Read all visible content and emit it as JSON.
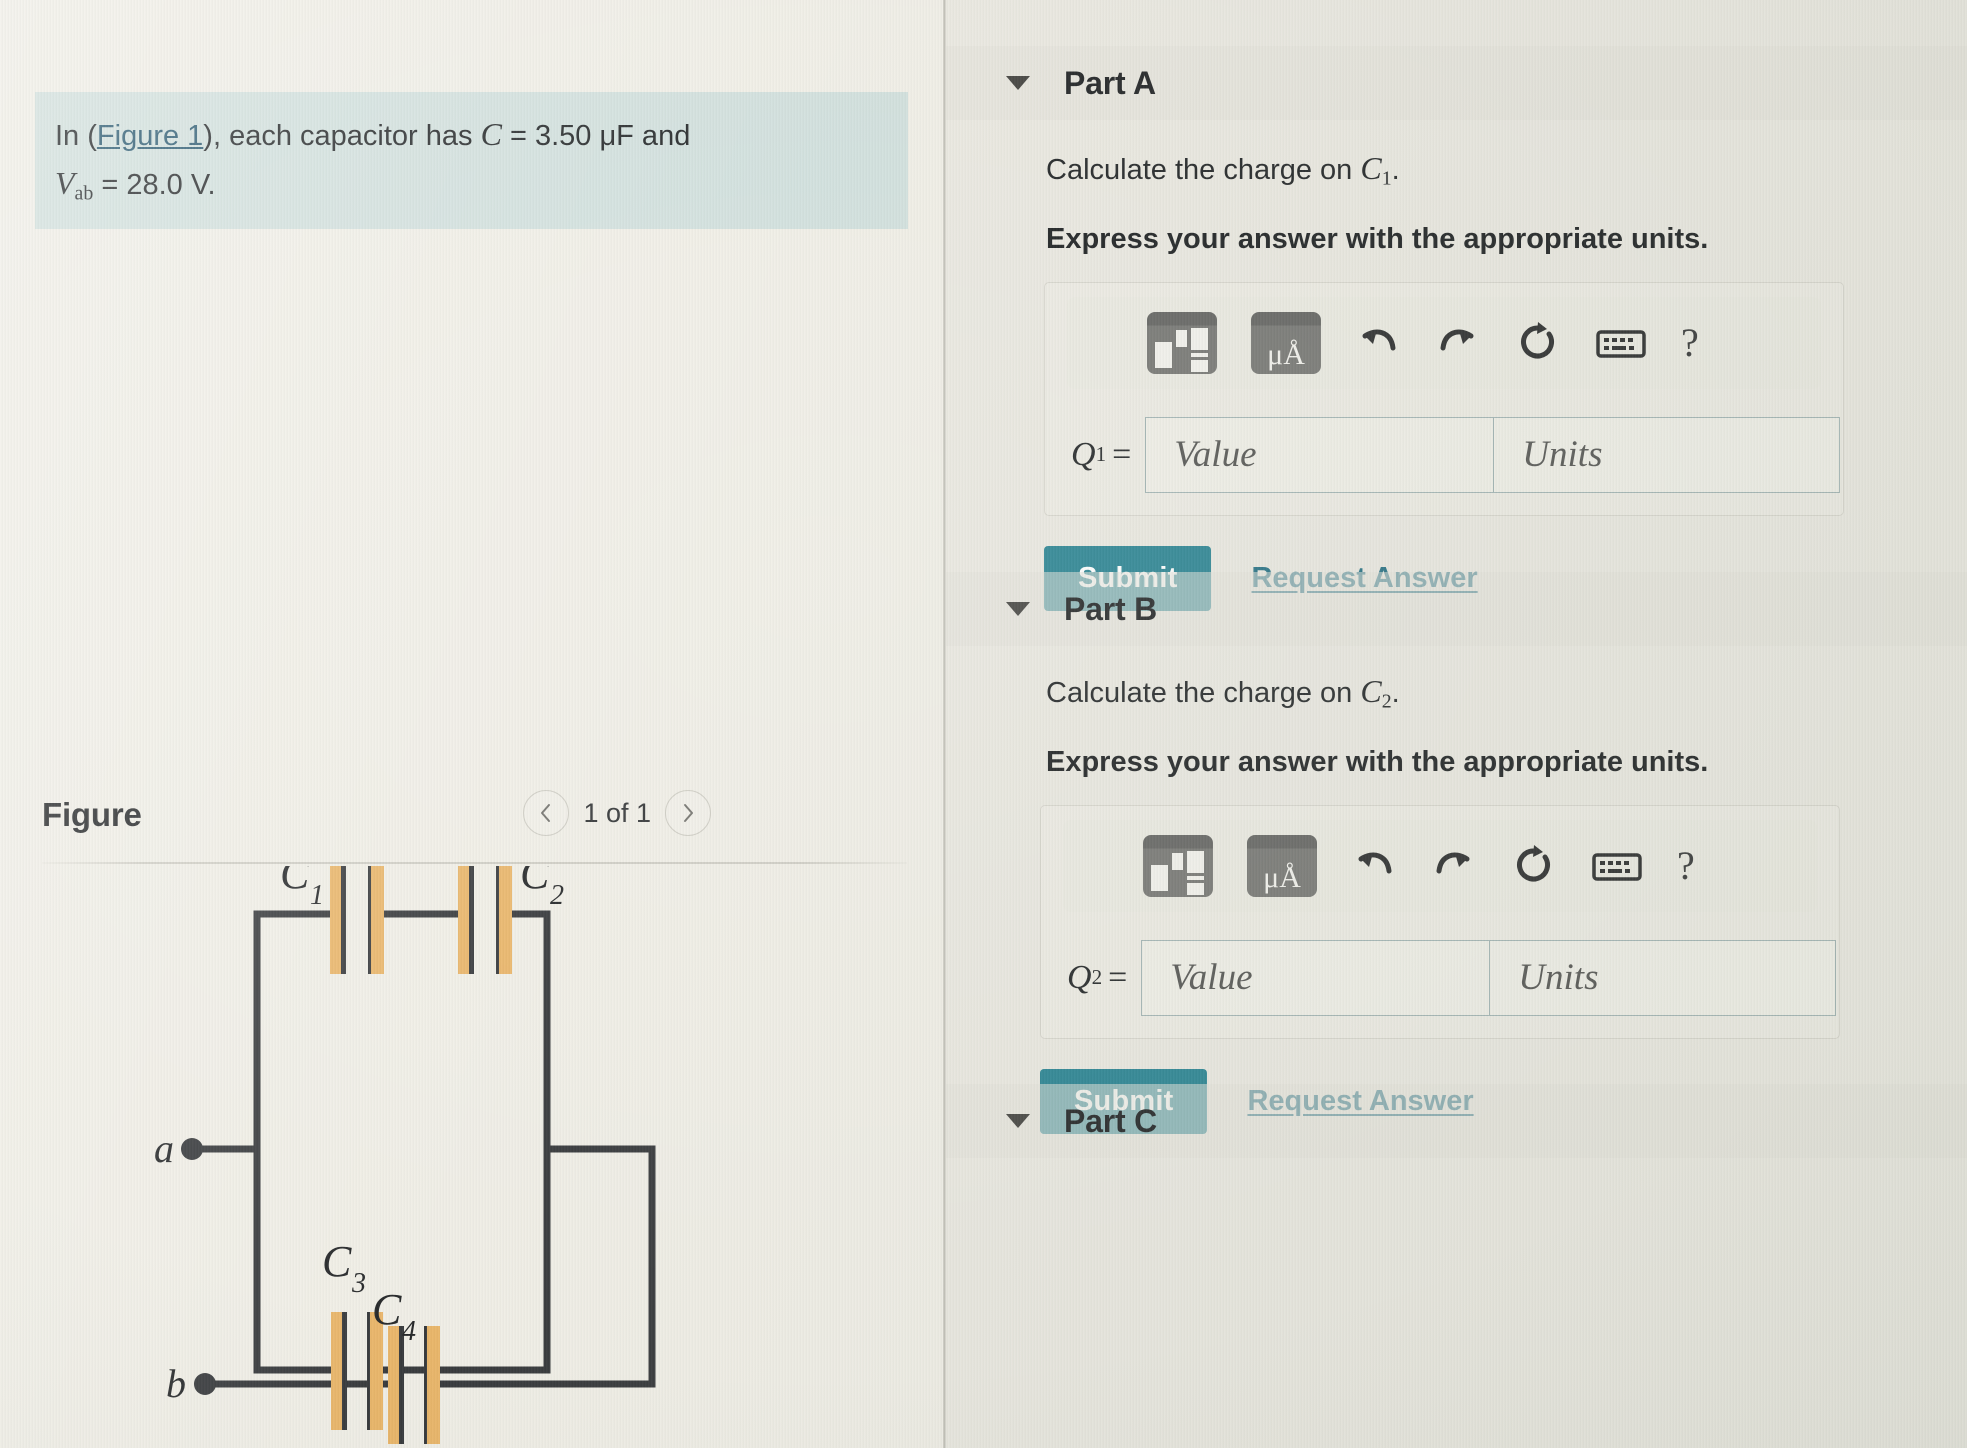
{
  "problem": {
    "text_prefix": "In (",
    "figure_link": "Figure 1",
    "text_mid": "), each capacitor has ",
    "capacitance_symbol": "C",
    "capacitance_value": " = 3.50 μF and",
    "voltage_symbol": "V",
    "voltage_subscript": "ab",
    "voltage_value": " = 28.0 V."
  },
  "figure": {
    "title": "Figure",
    "pager_label": "1 of 1",
    "prev_icon": "chevron-left-icon",
    "next_icon": "chevron-right-icon",
    "circuit": {
      "terminal_a": "a",
      "terminal_b": "b",
      "capacitors": [
        {
          "label": "C",
          "subscript": "1"
        },
        {
          "label": "C",
          "subscript": "2"
        },
        {
          "label": "C",
          "subscript": "3"
        },
        {
          "label": "C",
          "subscript": "4"
        }
      ],
      "wire_color": "#2e3033",
      "plate_color": "#e8b263"
    }
  },
  "parts": [
    {
      "id": "a",
      "header": "Part A",
      "caret_icon": "caret-down-icon",
      "prompt_prefix": "Calculate the charge on ",
      "prompt_symbol": "C",
      "prompt_subscript": "1",
      "prompt_suffix": ".",
      "instruction": "Express your answer with the appropriate units.",
      "toolbar": {
        "template_icon": "math-template-icon",
        "units_icon": "units-angstrom-icon",
        "units_glyph": "μÅ",
        "undo_icon": "undo-icon",
        "redo_icon": "redo-icon",
        "reset_icon": "reset-icon",
        "keyboard_icon": "keyboard-icon",
        "help_icon": "help-question-icon",
        "help_glyph": "?"
      },
      "answer": {
        "label_symbol": "Q",
        "label_subscript": "1",
        "label_equals": "=",
        "value_placeholder": "Value",
        "units_placeholder": "Units"
      },
      "submit_label": "Submit",
      "request_label": "Request Answer"
    },
    {
      "id": "b",
      "header": "Part B",
      "caret_icon": "caret-down-icon",
      "prompt_prefix": "Calculate the charge on ",
      "prompt_symbol": "C",
      "prompt_subscript": "2",
      "prompt_suffix": ".",
      "instruction": "Express your answer with the appropriate units.",
      "toolbar": {
        "template_icon": "math-template-icon",
        "units_icon": "units-angstrom-icon",
        "units_glyph": "μÅ",
        "undo_icon": "undo-icon",
        "redo_icon": "redo-icon",
        "reset_icon": "reset-icon",
        "keyboard_icon": "keyboard-icon",
        "help_icon": "help-question-icon",
        "help_glyph": "?"
      },
      "answer": {
        "label_symbol": "Q",
        "label_subscript": "2",
        "label_equals": "=",
        "value_placeholder": "Value",
        "units_placeholder": "Units"
      },
      "submit_label": "Submit",
      "request_label": "Request Answer"
    },
    {
      "id": "c",
      "header": "Part C",
      "caret_icon": "caret-down-icon"
    }
  ],
  "colors": {
    "accent_teal": "#1d7c8c",
    "link_teal": "#18677c",
    "highlight_bg": "#cfdedb",
    "left_bg": "#efede5",
    "right_bg": "#e9e7df",
    "wire": "#2e3033",
    "plate": "#e8b263"
  }
}
